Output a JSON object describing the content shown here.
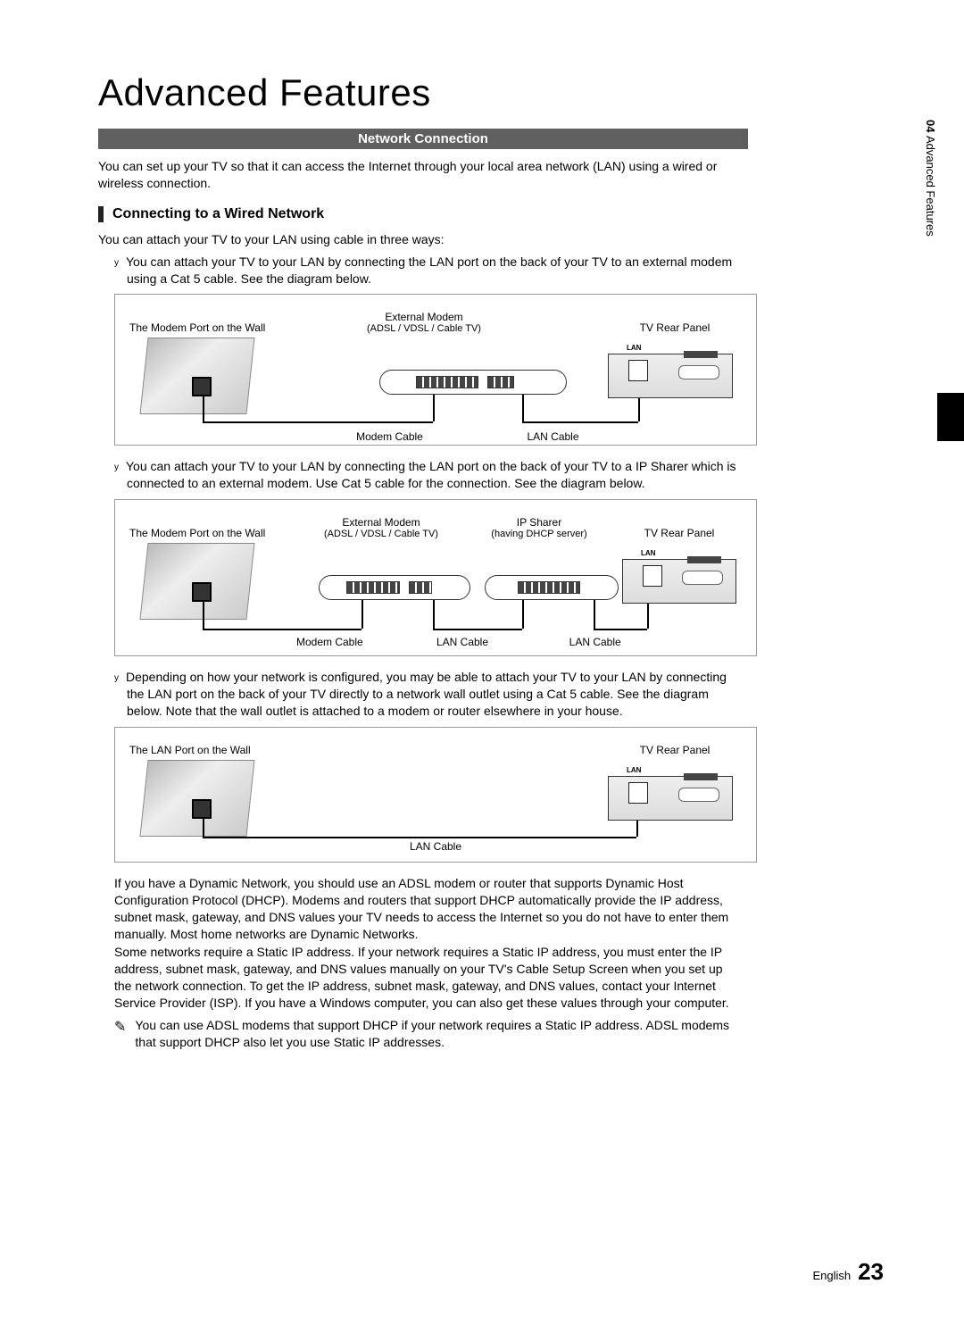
{
  "side_tab": {
    "chapter": "04",
    "label": "Advanced Features"
  },
  "page_title": "Advanced Features",
  "section_bar": "Network Connection",
  "intro": "You can set up your TV so that it can access the Internet through your local area network (LAN) using a wired or wireless connection.",
  "sub_heading": "Connecting to a Wired Network",
  "lead": "You can attach your TV to your LAN using cable in three ways:",
  "bullet1": "You can attach your TV to your LAN by connecting the LAN port on the back of your TV to an external modem using a Cat 5 cable. See the diagram below.",
  "bullet2": "You can attach your TV to your LAN by connecting the LAN port on the back of your TV to a IP Sharer which is connected to an external modem. Use Cat 5 cable for the connection. See the diagram below.",
  "bullet3": "Depending on how your network is configured, you may be able to attach your TV to your LAN by connecting the LAN port on the back of your TV directly to a network wall outlet using a Cat 5 cable. See the diagram below. Note that the wall outlet is attached to a modem or router elsewhere in your house.",
  "diagram1": {
    "wall": "The Modem Port on the Wall",
    "modem": "External Modem",
    "modem_sub": "(ADSL / VDSL / Cable TV)",
    "tv": "TV Rear Panel",
    "cable_left": "Modem Cable",
    "cable_right": "LAN Cable",
    "tv_lan": "LAN"
  },
  "diagram2": {
    "wall": "The Modem Port on the Wall",
    "modem": "External Modem",
    "modem_sub": "(ADSL / VDSL / Cable TV)",
    "sharer": "IP Sharer",
    "sharer_sub": "(having DHCP server)",
    "tv": "TV Rear Panel",
    "cable_left": "Modem Cable",
    "cable_mid": "LAN Cable",
    "cable_right": "LAN Cable",
    "tv_lan": "LAN"
  },
  "diagram3": {
    "wall": "The LAN Port on the Wall",
    "tv": "TV Rear Panel",
    "cable": "LAN Cable",
    "tv_lan": "LAN"
  },
  "explain1": "If you have a Dynamic Network, you should use an ADSL modem or router that supports Dynamic Host Configuration Protocol (DHCP). Modems and routers that support DHCP automatically provide the IP address, subnet mask, gateway, and DNS values your TV needs to access the Internet so you do not have to enter them manually. Most home networks are Dynamic Networks.",
  "explain2": "Some networks require a Static IP address. If your network requires a Static IP address, you must enter the IP address, subnet mask, gateway, and DNS values manually on your TV's Cable Setup Screen when you set up the network connection. To get the IP address, subnet mask, gateway, and DNS values, contact your Internet Service Provider (ISP). If you have a Windows computer, you can also get these values through your computer.",
  "note": "You can use ADSL modems that support DHCP if your network requires a Static IP address. ADSL modems that support DHCP also let you use Static IP addresses.",
  "footer": {
    "lang": "English",
    "page": "23"
  }
}
